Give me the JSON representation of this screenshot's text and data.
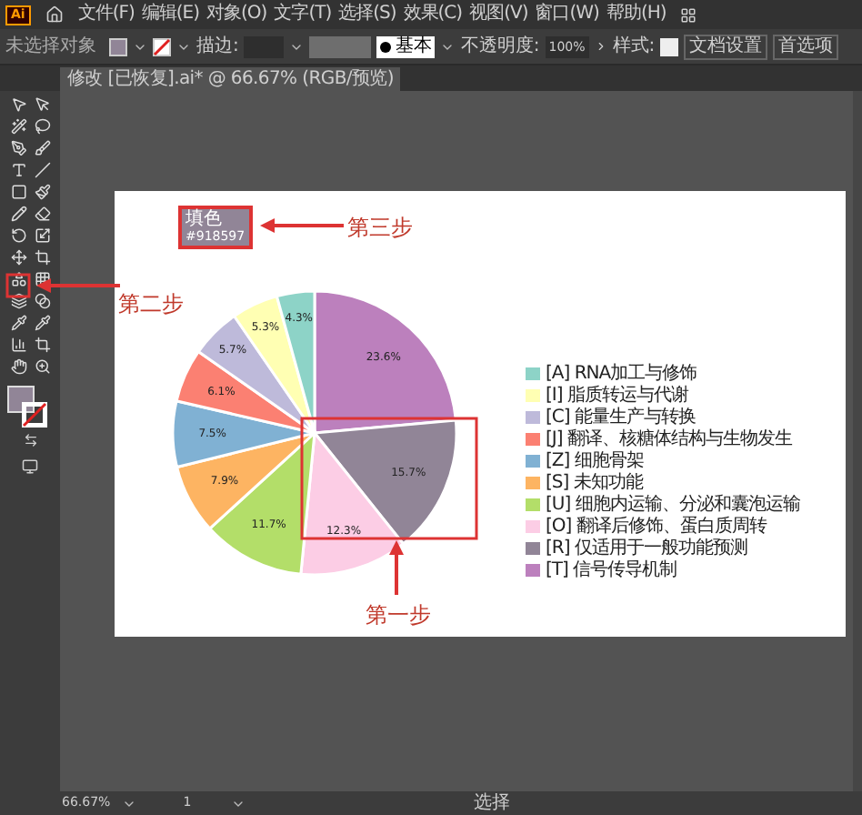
{
  "app_logo": "Ai",
  "menu": [
    "文件(F)",
    "编辑(E)",
    "对象(O)",
    "文字(T)",
    "选择(S)",
    "效果(C)",
    "视图(V)",
    "窗口(W)",
    "帮助(H)"
  ],
  "control_bar": {
    "selection": "未选择对象",
    "stroke_label": "描边:",
    "brush": "基本",
    "opacity_label": "不透明度:",
    "opacity": "100%",
    "style_label": "样式:",
    "buttons": [
      "文档设置",
      "首选项"
    ]
  },
  "tab": {
    "title": "修改 [已恢复].ai* @ 66.67% (RGB/预览)"
  },
  "tooltip": {
    "label": "填色",
    "value": "#918597"
  },
  "annotations": [
    "第三步",
    "第二步",
    "第一步"
  ],
  "chart": {
    "chart_data": {
      "type": "pie",
      "categories": [
        "[T] 信号传导机制",
        "[R] 仅适用于一般功能预测",
        "[O] 翻译后修饰、蛋白质周转",
        "[U] 细胞内运输、分泌和囊泡运输",
        "[S] 未知功能",
        "[Z] 细胞骨架",
        "[J] 翻译、核糖体结构与生物发生",
        "[C] 能量生产与转换",
        "[I] 脂质转运与代谢",
        "[A] RNA加工与修饰"
      ],
      "values": [
        23.6,
        15.7,
        12.3,
        11.7,
        7.9,
        7.5,
        6.1,
        5.7,
        5.3,
        4.3
      ],
      "value_labels": [
        "23.6%",
        "15.7%",
        "12.3%",
        "11.7%",
        "7.9%",
        "7.5%",
        "6.1%",
        "5.7%",
        "5.3%",
        "4.3%"
      ]
    },
    "slices": [
      {
        "color": "#bc80bd"
      },
      {
        "color": "#918597"
      },
      {
        "color": "#fccde5"
      },
      {
        "color": "#b3de69"
      },
      {
        "color": "#fdb462"
      },
      {
        "color": "#80b1d3"
      },
      {
        "color": "#fb8072"
      },
      {
        "color": "#bebada"
      },
      {
        "color": "#ffffb3"
      },
      {
        "color": "#8dd3c7"
      }
    ]
  },
  "status_bar": {
    "zoom": "66.67%",
    "page": "1",
    "mode": "选择"
  }
}
